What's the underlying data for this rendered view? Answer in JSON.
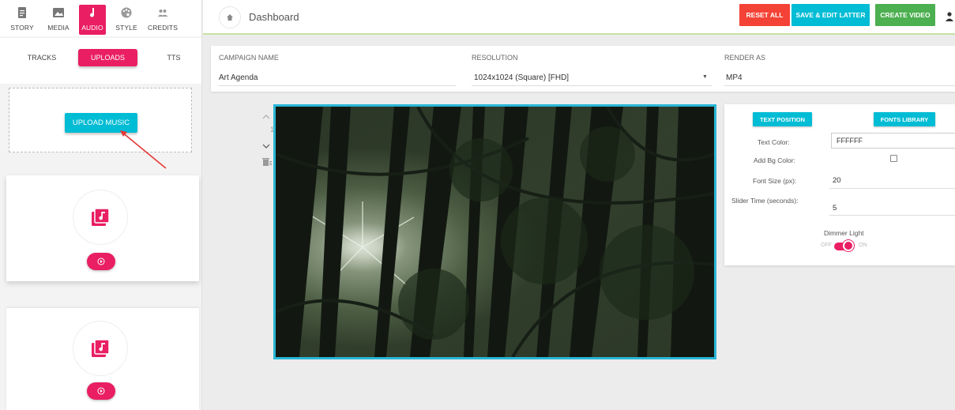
{
  "sidebar": {
    "nav": [
      {
        "label": "STORY",
        "icon": "document-icon"
      },
      {
        "label": "MEDIA",
        "icon": "image-icon"
      },
      {
        "label": "AUDIO",
        "icon": "music-note-icon",
        "active": true
      },
      {
        "label": "STYLE",
        "icon": "palette-icon"
      },
      {
        "label": "CREDITS",
        "icon": "people-icon"
      }
    ],
    "subtabs": [
      {
        "label": "TRACKS"
      },
      {
        "label": "UPLOADS",
        "active": true
      },
      {
        "label": "TTS"
      }
    ],
    "upload_button": "UPLOAD MUSIC"
  },
  "header": {
    "title": "Dashboard",
    "buttons": {
      "reset": "RESET ALL",
      "save": "SAVE & EDIT LATTER",
      "create": "CREATE VIDEO"
    }
  },
  "campaign": {
    "name_label": "CAMPAIGN NAME",
    "name_value": "Art Agenda",
    "resolution_label": "RESOLUTION",
    "resolution_value": "1024x1024 (Square) [FHD]",
    "render_label": "RENDER AS",
    "render_value": "MP4"
  },
  "slide": {
    "number": "1"
  },
  "panel": {
    "text_position_button": "TEXT POSITION",
    "fonts_library_button": "FONTS LIBRARY",
    "text_color_label": "Text Color:",
    "text_color_value": "FFFFFF",
    "bg_color_label": "Add Bg Color:",
    "font_size_label": "Font Size (px):",
    "font_size_value": "20",
    "slider_time_label": "Slider Time (seconds):",
    "slider_time_value": "5",
    "dimmer_label": "Dimmer Light",
    "dimmer_off": "OFF",
    "dimmer_on": "ON"
  },
  "colors": {
    "accent_pink": "#e91e63",
    "accent_cyan": "#00bcd4",
    "reset_red": "#f44336",
    "create_green": "#4caf50"
  }
}
